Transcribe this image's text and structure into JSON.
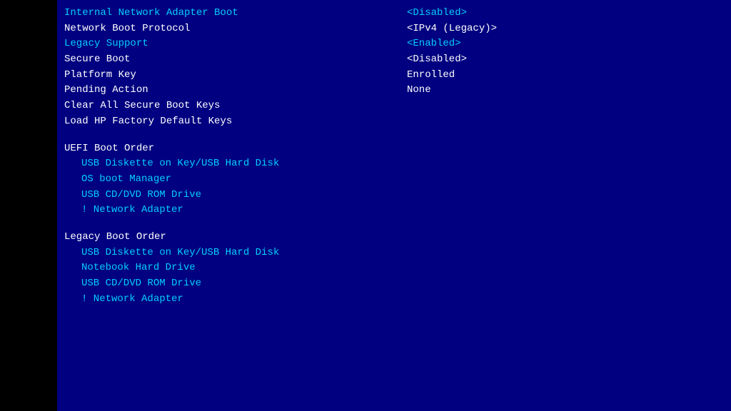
{
  "bios": {
    "rows": [
      {
        "label": "Internal Network Adapter Boot",
        "value": "<Disabled>",
        "labelColor": "blue",
        "valueColor": "blue"
      },
      {
        "label": "Network Boot Protocol",
        "value": "<IPv4 (Legacy)>",
        "labelColor": "white",
        "valueColor": "white"
      },
      {
        "label": "Legacy Support",
        "value": "<Enabled>",
        "labelColor": "blue",
        "valueColor": "blue"
      },
      {
        "label": "Secure Boot",
        "value": "<Disabled>",
        "labelColor": "white",
        "valueColor": "white"
      },
      {
        "label": "Platform Key",
        "value": "Enrolled",
        "labelColor": "white",
        "valueColor": "white"
      },
      {
        "label": "Pending Action",
        "value": "None",
        "labelColor": "white",
        "valueColor": "white"
      },
      {
        "label": "Clear All Secure Boot Keys",
        "value": "",
        "labelColor": "white",
        "valueColor": "white"
      },
      {
        "label": "Load HP Factory Default Keys",
        "value": "",
        "labelColor": "white",
        "valueColor": "white"
      }
    ],
    "uefi_section": "UEFI Boot Order",
    "uefi_items": [
      {
        "text": "USB Diskette on Key/USB Hard Disk",
        "color": "blue"
      },
      {
        "text": "OS boot Manager",
        "color": "blue"
      },
      {
        "text": "USB CD/DVD ROM Drive",
        "color": "blue"
      },
      {
        "text": "! Network Adapter",
        "color": "blue"
      }
    ],
    "legacy_section": "Legacy Boot Order",
    "legacy_items": [
      {
        "text": "USB Diskette on Key/USB Hard Disk",
        "color": "blue"
      },
      {
        "text": "Notebook Hard Drive",
        "color": "blue"
      },
      {
        "text": "USB CD/DVD ROM Drive",
        "color": "blue"
      },
      {
        "text": "! Network Adapter",
        "color": "blue"
      }
    ]
  }
}
